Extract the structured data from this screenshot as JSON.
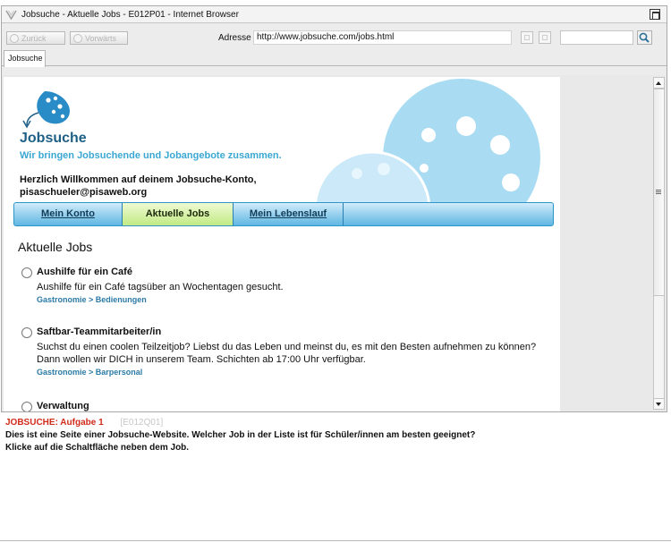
{
  "browser": {
    "window_title": "Jobsuche - Aktuelle Jobs - E012P01 - Internet Browser",
    "back_label": "Zurück",
    "forward_label": "Vorwärts",
    "address_label": "Adresse",
    "address_value": "http://www.jobsuche.com/jobs.html",
    "search_value": "",
    "tab_label": "Jobsuche"
  },
  "site": {
    "title": "Jobsuche",
    "tagline": "Wir bringen Jobsuchende und Jobangebote zusammen.",
    "welcome_line1": "Herzlich Willkommen auf deinem Jobsuche-Konto,",
    "welcome_line2": "pisaschueler@pisaweb.org",
    "menu": [
      "Mein Konto",
      "Aktuelle Jobs",
      "Mein Lebenslauf"
    ],
    "active_menu": "Aktuelle Jobs",
    "section_heading": "Aktuelle Jobs",
    "colors": {
      "brand_dark": "#1e5f86",
      "brand_light": "#3aa7d3",
      "bubble": "#a9dcf3",
      "menu_active": "#c2ea84"
    }
  },
  "jobs": [
    {
      "title": "Aushilfe für ein Café",
      "desc": "Aushilfe für ein Café tagsüber an Wochentagen gesucht.",
      "category": "Gastronomie > Bedienungen"
    },
    {
      "title": "Saftbar-Teammitarbeiter/in",
      "desc": "Suchst du einen coolen Teilzeitjob? Liebst du das Leben und meinst du, es mit den Besten aufnehmen zu können? Dann wollen wir DICH in unserem Team. Schichten ab 17:00 Uhr verfügbar.",
      "category": "Gastronomie > Barpersonal"
    },
    {
      "title": "Verwaltung",
      "desc": "",
      "category": ""
    }
  ],
  "task": {
    "label": "JOBSUCHE: Aufgabe 1",
    "code": "[E012Q01]",
    "line1": "Dies ist eine Seite einer Jobsuche-Website. Welcher Job in der Liste ist für Schüler/innen am besten geeignet?",
    "line2": "Klicke auf die Schaltfläche neben dem Job."
  }
}
